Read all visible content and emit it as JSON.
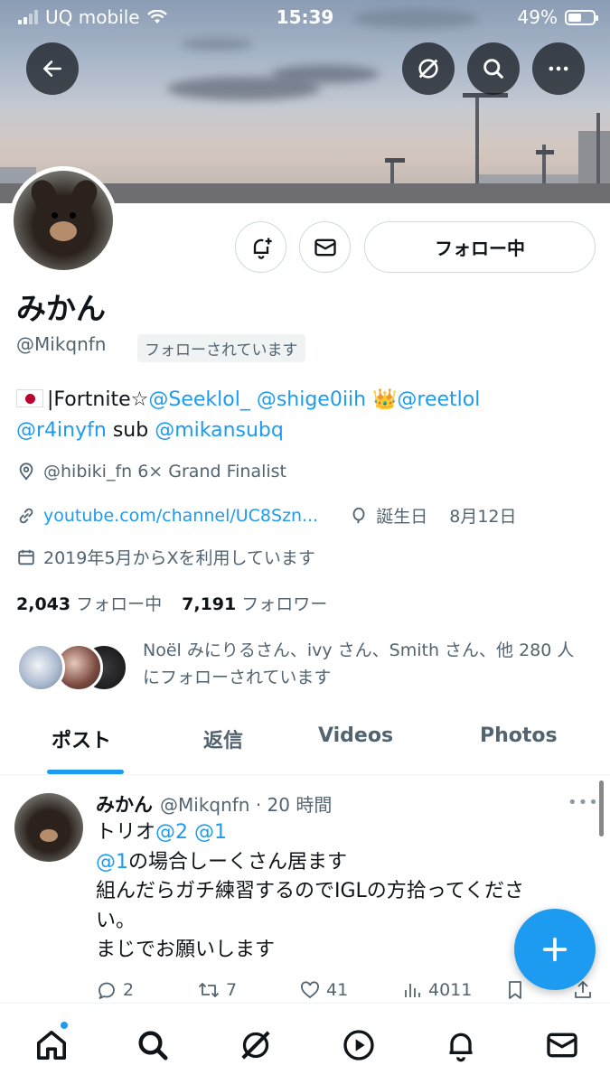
{
  "status_bar": {
    "carrier": "UQ mobile",
    "time": "15:39",
    "battery": "49%"
  },
  "profile": {
    "name": "みかん",
    "handle": "@Mikqnfn",
    "follows_you": "フォローされています",
    "following_button": "フォロー中",
    "bio": {
      "line1_prefix": "|Fortnite☆",
      "mention1": "@Seeklol_",
      "mention2": "@shige0iih",
      "crown": "👑",
      "mention3": "@reetlol",
      "mention4": "@r4inyfn",
      "sub_word": "sub",
      "mention5": "@mikansubq"
    },
    "location": "@hibiki_fn  6× Grand Finalist",
    "website": "youtube.com/channel/UC8Szn...",
    "birthday_label": "誕生日",
    "birthday": "8月12日",
    "joined": "2019年5月からXを利用しています",
    "following_count": "2,043",
    "following_label": "フォロー中",
    "followers_count": "7,191",
    "followers_label": "フォロワー",
    "followed_by_line1": "Noël みにりるさん、ivy さん、Smith さん、他 280 人",
    "followed_by_line2": "にフォローされています"
  },
  "tabs": [
    "ポスト",
    "返信",
    "Videos",
    "Photos"
  ],
  "post": {
    "name": "みかん",
    "handle_time": "@Mikqnfn · 20 時間",
    "line1_prefix": "トリオ",
    "line1_link": "@2 @1",
    "line2_link": "@1",
    "line2_suffix": "の場合しーくさん居ます",
    "line3": "組んだらガチ練習するのでIGLの方拾ってくださ",
    "line4": "い。",
    "line5": "まじでお願いします",
    "replies": "2",
    "reposts": "7",
    "likes": "41",
    "views": "4011"
  },
  "icons": {
    "back": "arrow-left-icon",
    "grok": "grok-icon",
    "search": "search-icon",
    "more": "more-icon",
    "notify": "bell-plus-icon",
    "message": "mail-icon"
  },
  "colors": {
    "accent": "#1d9bf0",
    "text": "#0f1419",
    "muted": "#536471"
  }
}
